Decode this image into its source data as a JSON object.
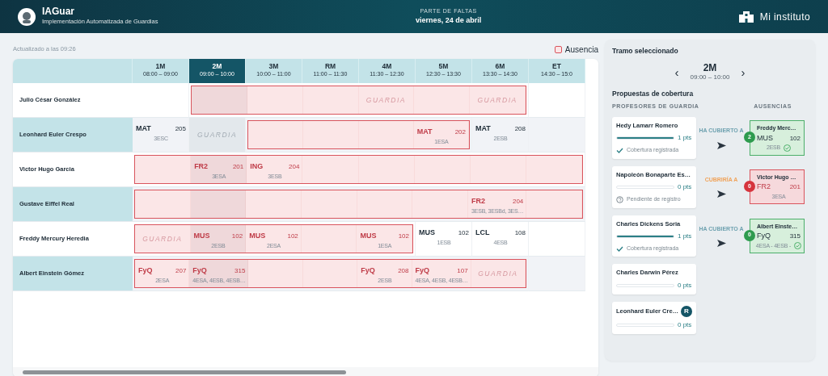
{
  "app": {
    "title": "IAGuar",
    "subtitle": "Implementación Automatizada de Guardias",
    "report_label": "PARTE DE FALTAS",
    "date": "viernes, 24 de abril",
    "school": "Mi instituto"
  },
  "updated": "Actualizado a las 09:26",
  "legend": {
    "label": "Ausencia"
  },
  "periods": [
    {
      "code": "1M",
      "time": "08:00 – 09:00",
      "selected": false
    },
    {
      "code": "2M",
      "time": "09:00 – 10:00",
      "selected": true
    },
    {
      "code": "3M",
      "time": "10:00 – 11:00",
      "selected": false
    },
    {
      "code": "RM",
      "time": "11:00 – 11:30",
      "selected": false
    },
    {
      "code": "4M",
      "time": "11:30 – 12:30",
      "selected": false
    },
    {
      "code": "5M",
      "time": "12:30 – 13:30",
      "selected": false
    },
    {
      "code": "6M",
      "time": "13:30 – 14:30",
      "selected": false
    },
    {
      "code": "ET",
      "time": "14:30 – 15:0",
      "selected": false
    }
  ],
  "rows": [
    {
      "name": "Julio César González",
      "segments": [
        {
          "absent": false,
          "cells": [
            {
              "kind": "empty"
            }
          ]
        },
        {
          "absent": true,
          "cells": [
            {
              "kind": "empty"
            },
            {
              "kind": "empty"
            },
            {
              "kind": "empty"
            },
            {
              "kind": "guardia",
              "text": "GUARDIA"
            },
            {
              "kind": "empty"
            },
            {
              "kind": "guardia",
              "text": "GUARDIA"
            }
          ]
        },
        {
          "absent": false,
          "cells": [
            {
              "kind": "empty"
            }
          ]
        }
      ]
    },
    {
      "name": "Leonhard Euler Crespo",
      "segments": [
        {
          "absent": false,
          "cells": [
            {
              "kind": "class",
              "subject": "MAT",
              "room": "205",
              "group": "3ESC"
            },
            {
              "kind": "guardia",
              "text": "GUARDIA"
            }
          ]
        },
        {
          "absent": true,
          "cells": [
            {
              "kind": "empty"
            },
            {
              "kind": "empty"
            },
            {
              "kind": "empty"
            },
            {
              "kind": "class",
              "subject": "MAT",
              "room": "202",
              "group": "1ESA"
            }
          ]
        },
        {
          "absent": false,
          "cells": [
            {
              "kind": "class",
              "subject": "MAT",
              "room": "208",
              "group": "2ESB"
            },
            {
              "kind": "empty"
            }
          ]
        }
      ]
    },
    {
      "name": "Victor Hugo Garcia",
      "segments": [
        {
          "absent": true,
          "cells": [
            {
              "kind": "empty"
            },
            {
              "kind": "class",
              "subject": "FR2",
              "room": "201",
              "group": "3ESA"
            },
            {
              "kind": "class",
              "subject": "ING",
              "room": "204",
              "group": "3ESB"
            },
            {
              "kind": "empty"
            },
            {
              "kind": "empty"
            },
            {
              "kind": "empty"
            },
            {
              "kind": "empty"
            },
            {
              "kind": "empty"
            }
          ]
        }
      ]
    },
    {
      "name": "Gustave Eiffel Real",
      "segments": [
        {
          "absent": true,
          "cells": [
            {
              "kind": "empty"
            },
            {
              "kind": "empty"
            },
            {
              "kind": "empty"
            },
            {
              "kind": "empty"
            },
            {
              "kind": "empty"
            },
            {
              "kind": "empty"
            },
            {
              "kind": "class",
              "subject": "FR2",
              "room": "204",
              "group": "3ESB, 3ESBd, 3ES…"
            },
            {
              "kind": "empty"
            }
          ]
        }
      ]
    },
    {
      "name": "Freddy Mercury Heredia",
      "segments": [
        {
          "absent": true,
          "cells": [
            {
              "kind": "guardia",
              "text": "GUARDIA"
            },
            {
              "kind": "class",
              "subject": "MUS",
              "room": "102",
              "group": "2ESB"
            },
            {
              "kind": "class",
              "subject": "MUS",
              "room": "102",
              "group": "2ESA"
            },
            {
              "kind": "empty"
            },
            {
              "kind": "class",
              "subject": "MUS",
              "room": "102",
              "group": "1ESA"
            }
          ]
        },
        {
          "absent": false,
          "cells": [
            {
              "kind": "class",
              "subject": "MUS",
              "room": "102",
              "group": "1ESB"
            },
            {
              "kind": "class",
              "subject": "LCL",
              "room": "108",
              "group": "4ESB"
            },
            {
              "kind": "empty"
            }
          ]
        }
      ]
    },
    {
      "name": "Albert Einstein Gómez",
      "segments": [
        {
          "absent": true,
          "cells": [
            {
              "kind": "class",
              "subject": "FyQ",
              "room": "207",
              "group": "2ESA"
            },
            {
              "kind": "class",
              "subject": "FyQ",
              "room": "315",
              "group": "4ESA, 4ESB, 4ESB…"
            },
            {
              "kind": "empty"
            },
            {
              "kind": "empty"
            },
            {
              "kind": "class",
              "subject": "FyQ",
              "room": "208",
              "group": "2ESB"
            },
            {
              "kind": "class",
              "subject": "FyQ",
              "room": "107",
              "group": "4ESA, 4ESB, 4ESB…"
            },
            {
              "kind": "guardia",
              "text": "GUARDIA"
            }
          ]
        },
        {
          "absent": false,
          "cells": [
            {
              "kind": "empty"
            }
          ]
        }
      ]
    }
  ],
  "panel": {
    "title": "Tramo seleccionado",
    "prev": "‹",
    "next": "›",
    "period_code": "2M",
    "period_time": "09:00 – 10:00",
    "proposals_title": "Propuestas de cobertura",
    "left_heading": "PROFESORES DE GUARDIA",
    "right_heading": "AUSENCIAS",
    "teachers": [
      {
        "name": "Hedy Lamarr Romero",
        "level": 1,
        "points": "1 pts",
        "kind": "registered",
        "status_text": "Cobertura registrada",
        "match": {
          "kind": "covered",
          "label": "HA CUBIERTO A",
          "teacher": "Freddy Merc…",
          "count": "2",
          "subject": "MUS",
          "room": "102",
          "group": "2ESB"
        }
      },
      {
        "name": "Napoleón Bonaparte Es…",
        "level": 0,
        "points": "0 pts",
        "kind": "pending",
        "status_text": "Pendiente de registro",
        "match": {
          "kind": "proposed",
          "label": "CUBRIRÍA A",
          "teacher": "Victor Hugo …",
          "count": "0",
          "subject": "FR2",
          "room": "201",
          "group": "3ESA"
        }
      },
      {
        "name": "Charles Dickens Soria",
        "level": 1,
        "points": "1 pts",
        "kind": "registered",
        "status_text": "Cobertura registrada",
        "match": {
          "kind": "covered",
          "label": "HA CUBIERTO A",
          "teacher": "Albert Einste…",
          "count": "0",
          "subject": "FyQ",
          "room": "315",
          "group": "4ESA - 4ESB -"
        }
      },
      {
        "name": "Charles Darwin Pérez",
        "level": 0,
        "points": "0 pts"
      },
      {
        "name": "Leonhard Euler Cre…",
        "badge": "R",
        "level": 0,
        "points": "0 pts"
      }
    ]
  }
}
